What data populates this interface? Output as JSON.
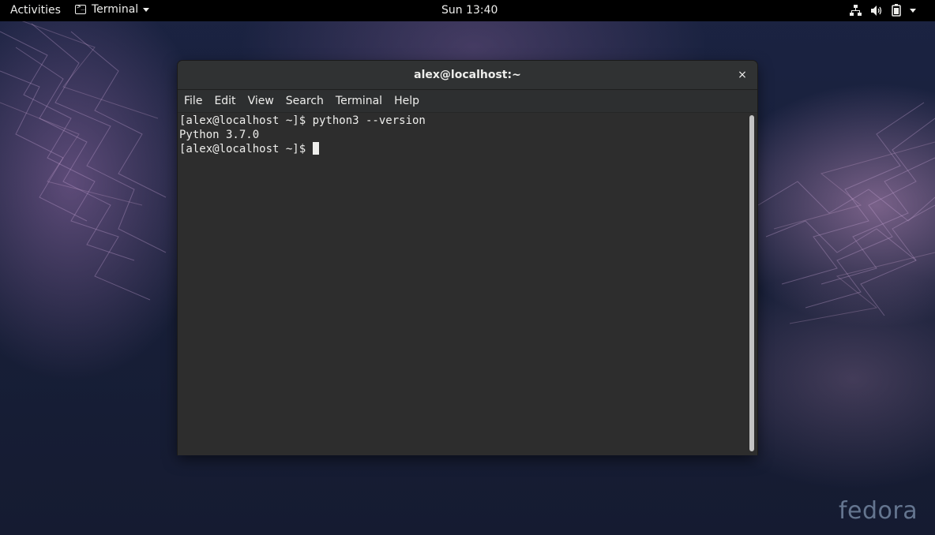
{
  "topbar": {
    "activities_label": "Activities",
    "app_menu_label": "Terminal",
    "clock": "Sun 13:40",
    "icons": [
      "network-icon",
      "volume-icon",
      "battery-icon",
      "system-menu-arrow-icon"
    ]
  },
  "window": {
    "title": "alex@localhost:~",
    "close_glyph": "×",
    "menu": [
      "File",
      "Edit",
      "View",
      "Search",
      "Terminal",
      "Help"
    ]
  },
  "terminal": {
    "lines": [
      "[alex@localhost ~]$ python3 --version",
      "Python 3.7.0",
      "[alex@localhost ~]$ "
    ]
  },
  "desktop": {
    "watermark": "fedora"
  },
  "colors": {
    "topbar_bg": "#000000",
    "terminal_bg": "#2d2d2d",
    "terminal_fg": "#eeeeec",
    "desktop_bg": "#18203a"
  }
}
